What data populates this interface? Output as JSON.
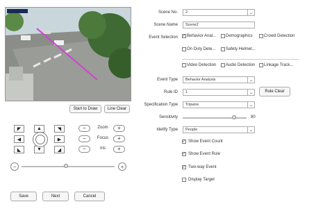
{
  "video": {
    "buttons": {
      "start_draw": "Start to Draw",
      "line_clear": "Line Clear"
    }
  },
  "ptz": {
    "zoom_label": "Zoom",
    "focus_label": "Focus",
    "iris_label": "Iris",
    "minus": "−",
    "plus": "+",
    "arrows": {
      "up": "▲",
      "down": "▼",
      "left": "◀",
      "right": "▶",
      "up_left": "◤",
      "up_right": "◥",
      "down_left": "◣",
      "down_right": "◢"
    },
    "speed_level": 0.48
  },
  "form": {
    "scene_no": {
      "label": "Scene No.",
      "value": "2"
    },
    "scene_name": {
      "label": "Scene Name",
      "value": "Scene2"
    },
    "event_selection": {
      "label": "Event Selection",
      "options": [
        {
          "text": "Behavior Anal...",
          "checked": true
        },
        {
          "text": "Demographics",
          "checked": false
        },
        {
          "text": "Crowd Detection",
          "checked": false
        },
        {
          "text": "On Duty Dete...",
          "checked": false
        },
        {
          "text": "Safety Helmet...",
          "checked": false
        },
        {
          "text": "Video Detection",
          "checked": false
        },
        {
          "text": "Audio Detection",
          "checked": false
        },
        {
          "text": "Linkage Track...",
          "checked": false
        }
      ]
    },
    "event_type": {
      "label": "Event Type",
      "value": "Behavior Analysis"
    },
    "rule_id": {
      "label": "Rule ID",
      "value": "1",
      "button": "Rule Clear"
    },
    "spec_type": {
      "label": "Specification Type",
      "value": "Tripwire"
    },
    "sensitivity": {
      "label": "Sensitivity",
      "value": "80",
      "level": 0.8
    },
    "identify_type": {
      "label": "Idetify Type",
      "value": "People"
    },
    "checks": [
      {
        "text": "Show Event Count",
        "checked": true
      },
      {
        "text": "Show Event Rule",
        "checked": true
      },
      {
        "text": "Two-way Event",
        "checked": true
      },
      {
        "text": "Display Target",
        "checked": false
      }
    ]
  },
  "footer": {
    "save": "Save",
    "next": "Next",
    "cancel": "Cancel"
  },
  "colors": {
    "tripwire": "#d23fd6",
    "border": "#aaaaaa"
  }
}
